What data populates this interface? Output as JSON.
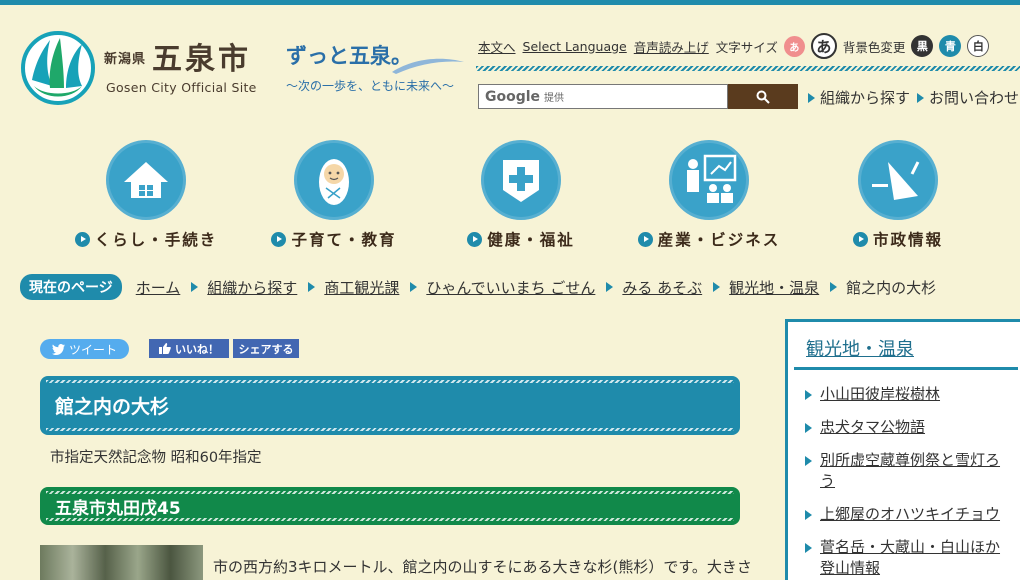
{
  "header": {
    "prefecture": "新潟県",
    "city": "五泉市",
    "city_en": "Gosen City Official Site",
    "slogan": "ずっと五泉。",
    "slogan_sub": "～次の一歩を、ともに未来へ～"
  },
  "utility": {
    "main_text": "本文へ",
    "select_language": "Select Language",
    "read_aloud": "音声読み上げ",
    "font_size_label": "文字サイズ",
    "font_small": "あ",
    "font_large": "あ",
    "bg_label": "背景色変更",
    "bg_black": "黒",
    "bg_blue": "青",
    "bg_white": "白"
  },
  "search": {
    "brand": "Google",
    "provided": "提供",
    "button_icon": "search-icon"
  },
  "quick_links": {
    "org": "組織から探す",
    "contact": "お問い合わせ"
  },
  "nav": [
    {
      "label": "くらし・手続き",
      "icon": "house-icon"
    },
    {
      "label": "子育て・教育",
      "icon": "baby-icon"
    },
    {
      "label": "健康・福祉",
      "icon": "health-cross-icon"
    },
    {
      "label": "産業・ビジネス",
      "icon": "presentation-icon"
    },
    {
      "label": "市政情報",
      "icon": "megaphone-icon"
    }
  ],
  "breadcrumb": {
    "label": "現在のページ",
    "items": [
      "ホーム",
      "組織から探す",
      "商工観光課",
      "ひゃんでいいまち ごせん",
      "みる あそぶ",
      "観光地・温泉"
    ],
    "current": "館之内の大杉"
  },
  "social": {
    "tweet": "ツイート",
    "like": "いいね！",
    "share": "シェアする"
  },
  "main": {
    "title": "館之内の大杉",
    "designation": "市指定天然記念物 昭和60年指定",
    "address_heading": "五泉市丸田戊45",
    "description": "市の西方約3キロメートル、館之内の山すそにある大きな杉(熊杉）です。大きさ"
  },
  "sidebar": {
    "title": "観光地・温泉",
    "items": [
      "小山田彼岸桜樹林",
      "忠犬タマ公物語",
      "別所虚空蔵尊例祭と雪灯ろう",
      "上郷屋のオハツキイチョウ",
      "菅名岳・大蔵山・白山ほか登山情報"
    ]
  },
  "colors": {
    "teal": "#1f8bab",
    "green": "#11894a",
    "background": "#f7f3d6",
    "search_button": "#5a3b1e"
  }
}
